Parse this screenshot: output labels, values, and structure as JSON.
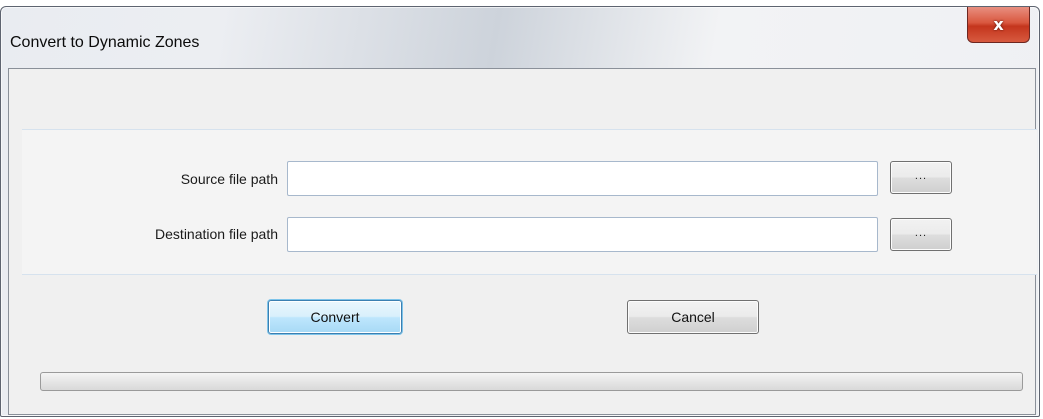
{
  "window": {
    "title": "Convert to Dynamic Zones",
    "close_icon": "close-icon",
    "close_glyph": "x"
  },
  "form": {
    "source_label": "Source file path",
    "source_value": "",
    "source_browse_label": "...",
    "destination_label": "Destination file path",
    "destination_value": "",
    "destination_browse_label": "..."
  },
  "actions": {
    "convert_label": "Convert",
    "cancel_label": "Cancel"
  },
  "progress": {
    "fraction": 0
  },
  "colors": {
    "close_button": "#c4351d",
    "default_button_border": "#3c7fb1",
    "progress_fill": "#06b025"
  }
}
